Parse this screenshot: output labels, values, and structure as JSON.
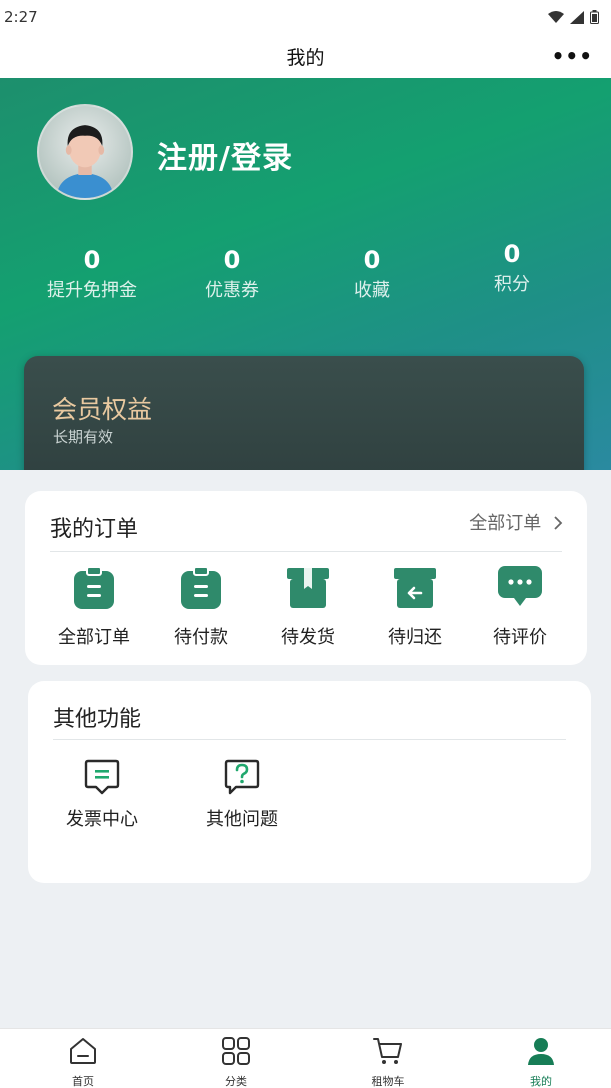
{
  "status": {
    "time": "2:27"
  },
  "nav": {
    "title": "我的",
    "more": "•••"
  },
  "profile": {
    "login_label": "注册/登录"
  },
  "stats": [
    {
      "value": "0",
      "label": "提升免押金"
    },
    {
      "value": "0",
      "label": "优惠券"
    },
    {
      "value": "0",
      "label": "收藏"
    },
    {
      "value": "0",
      "label": "积分"
    }
  ],
  "member": {
    "title": "会员权益",
    "subtitle": "长期有效"
  },
  "orders": {
    "title": "我的订单",
    "all_link": "全部订单",
    "items": [
      {
        "label": "全部订单",
        "icon": "clipboard-icon"
      },
      {
        "label": "待付款",
        "icon": "clipboard-icon"
      },
      {
        "label": "待发货",
        "icon": "box-icon"
      },
      {
        "label": "待归还",
        "icon": "return-box-icon"
      },
      {
        "label": "待评价",
        "icon": "chat-bubble-icon"
      }
    ]
  },
  "other": {
    "title": "其他功能",
    "items": [
      {
        "label": "发票中心",
        "icon": "invoice-icon"
      },
      {
        "label": "其他问题",
        "icon": "question-icon"
      }
    ]
  },
  "tabs": [
    {
      "label": "首页",
      "icon": "home-icon"
    },
    {
      "label": "分类",
      "icon": "grid-icon"
    },
    {
      "label": "租物车",
      "icon": "cart-icon"
    },
    {
      "label": "我的",
      "icon": "user-icon"
    }
  ],
  "colors": {
    "accent": "#177d56",
    "hero_start": "#1d8f6d",
    "hero_end": "#2a8aa0",
    "member_gold": "#e9c9a0"
  }
}
